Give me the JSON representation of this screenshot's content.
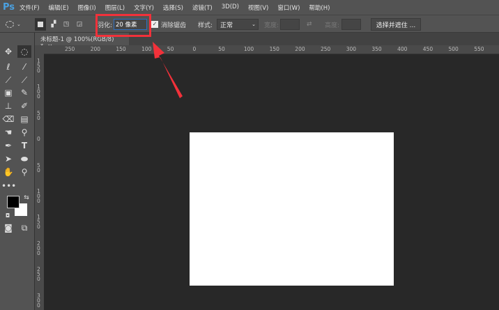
{
  "app": {
    "logo": "Ps"
  },
  "menu": [
    "文件(F)",
    "编辑(E)",
    "图像(I)",
    "图层(L)",
    "文字(Y)",
    "选择(S)",
    "滤镜(T)",
    "3D(D)",
    "视图(V)",
    "窗口(W)",
    "帮助(H)"
  ],
  "options": {
    "feather_label": "羽化:",
    "feather_value": "20 像素",
    "antialias_label": "消除锯齿",
    "antialias_checked": true,
    "style_label": "样式:",
    "style_value": "正常",
    "width_label": "宽度:",
    "height_label": "高度:",
    "select_mask_button": "选择并遮住 ..."
  },
  "document_tab": {
    "title": "未标题-1 @ 100%(RGB/8) *",
    "close": "×"
  },
  "rulers": {
    "horizontal": [
      "250",
      "200",
      "150",
      "100",
      "50",
      "0",
      "50",
      "100",
      "150",
      "200",
      "250",
      "300",
      "350",
      "400",
      "450",
      "500",
      "550",
      "600"
    ],
    "vertical": [
      "150",
      "100",
      "50",
      "0",
      "50",
      "100",
      "150",
      "200",
      "250",
      "300"
    ]
  },
  "colors": {
    "highlight": "#f2313a",
    "foreground": "#000000",
    "background": "#ffffff"
  }
}
